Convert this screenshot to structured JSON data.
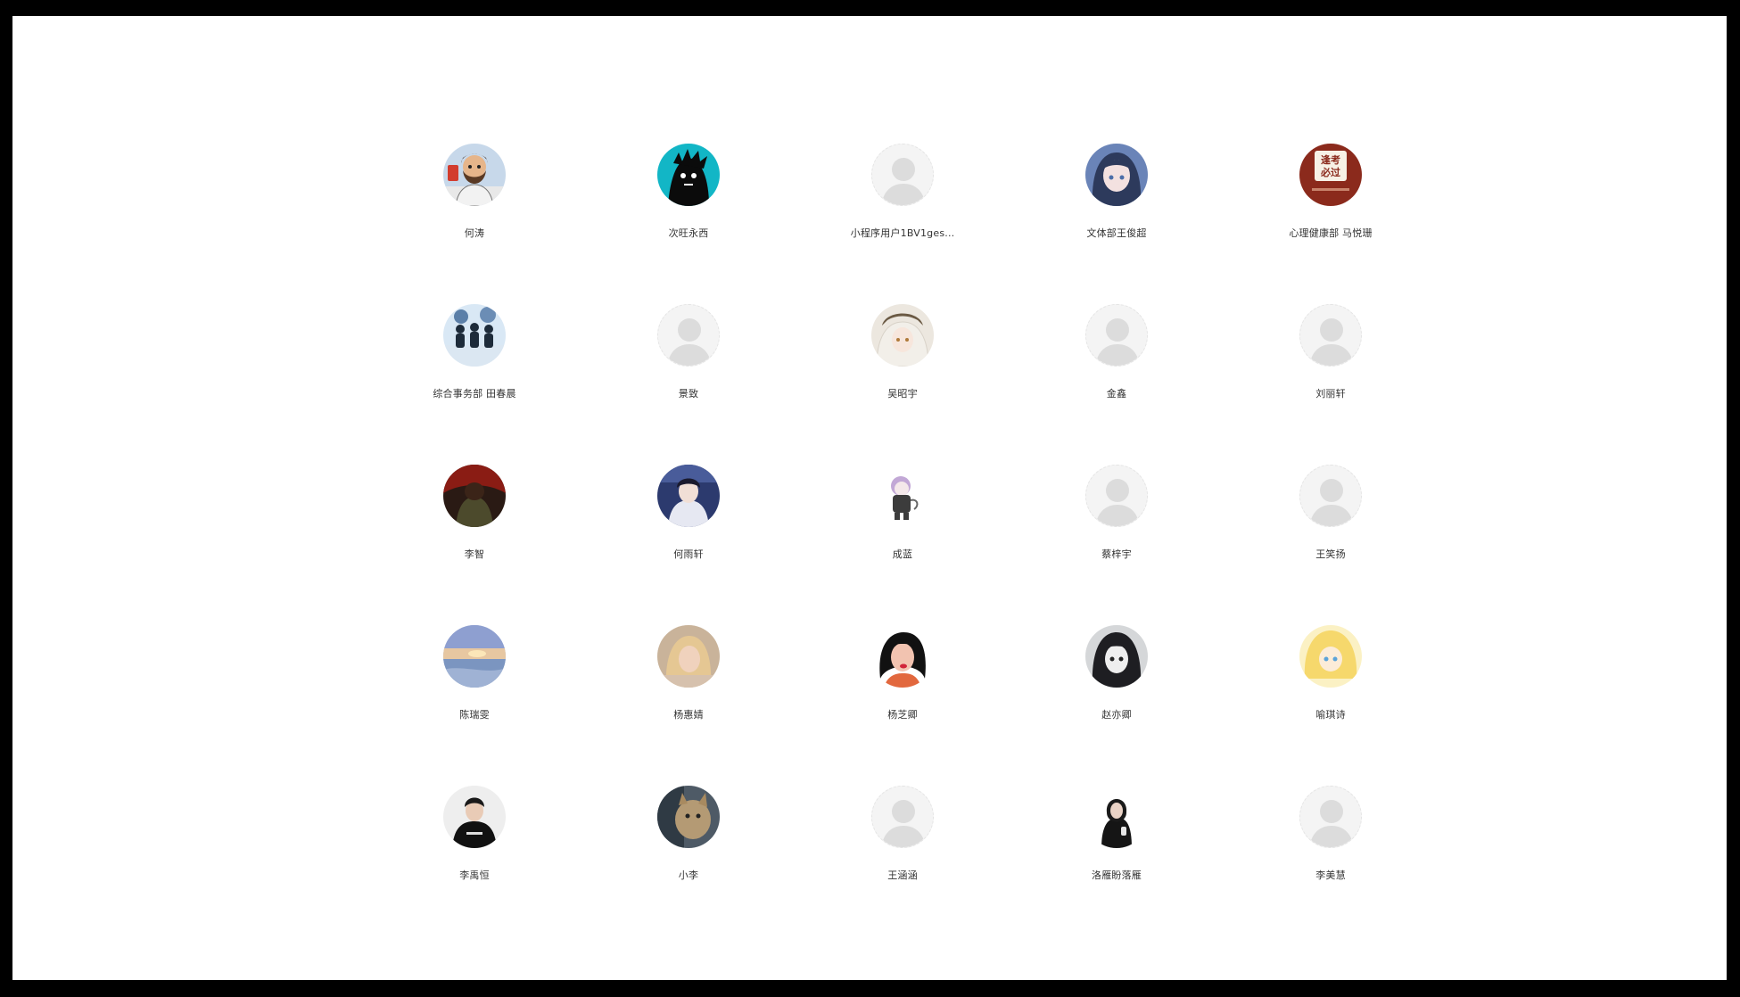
{
  "colors": {
    "outer_border": "#000000",
    "background": "#ffffff",
    "name_text": "#333333",
    "default_avatar_bg": "#f4f4f4",
    "default_avatar_silhouette": "#dcdcdc"
  },
  "members": [
    {
      "name": "何涛",
      "avatar": "avatar-bearded-man-icon"
    },
    {
      "name": "次旺永西",
      "avatar": "avatar-cartoon-monster-icon"
    },
    {
      "name": "小程序用户1BV1ges...",
      "avatar": "default-avatar-icon"
    },
    {
      "name": "文体部王俊超",
      "avatar": "avatar-anime-girl-icon"
    },
    {
      "name": "心理健康部 马悦珊",
      "avatar": "avatar-exam-pass-badge-icon",
      "badge_text": [
        "逢考",
        "必过"
      ]
    },
    {
      "name": "综合事务部 田春晨",
      "avatar": "avatar-group-figures-icon"
    },
    {
      "name": "景致",
      "avatar": "default-avatar-icon"
    },
    {
      "name": "吴昭宇",
      "avatar": "avatar-anime-white-hair-icon"
    },
    {
      "name": "金鑫",
      "avatar": "default-avatar-icon"
    },
    {
      "name": "刘丽轩",
      "avatar": "default-avatar-icon"
    },
    {
      "name": "李智",
      "avatar": "avatar-dark-red-figure-icon"
    },
    {
      "name": "何雨轩",
      "avatar": "avatar-anime-boy-icon"
    },
    {
      "name": "成蓝",
      "avatar": "avatar-chibi-character-icon"
    },
    {
      "name": "蔡梓宇",
      "avatar": "default-avatar-icon"
    },
    {
      "name": "王笑扬",
      "avatar": "default-avatar-icon"
    },
    {
      "name": "陈瑞雯",
      "avatar": "avatar-sunset-sea-icon"
    },
    {
      "name": "杨惠婧",
      "avatar": "avatar-blonde-portrait-icon"
    },
    {
      "name": "杨芝卿",
      "avatar": "avatar-comic-woman-icon"
    },
    {
      "name": "赵亦卿",
      "avatar": "avatar-manga-girl-icon"
    },
    {
      "name": "喻琪诗",
      "avatar": "avatar-yellow-anime-icon"
    },
    {
      "name": "李禹恒",
      "avatar": "avatar-young-man-black-icon"
    },
    {
      "name": "小李",
      "avatar": "avatar-cat-photo-icon"
    },
    {
      "name": "王涵涵",
      "avatar": "default-avatar-icon"
    },
    {
      "name": "洛雁盼落雁",
      "avatar": "avatar-woman-dark-outfit-icon"
    },
    {
      "name": "李美慧",
      "avatar": "default-avatar-icon"
    }
  ]
}
